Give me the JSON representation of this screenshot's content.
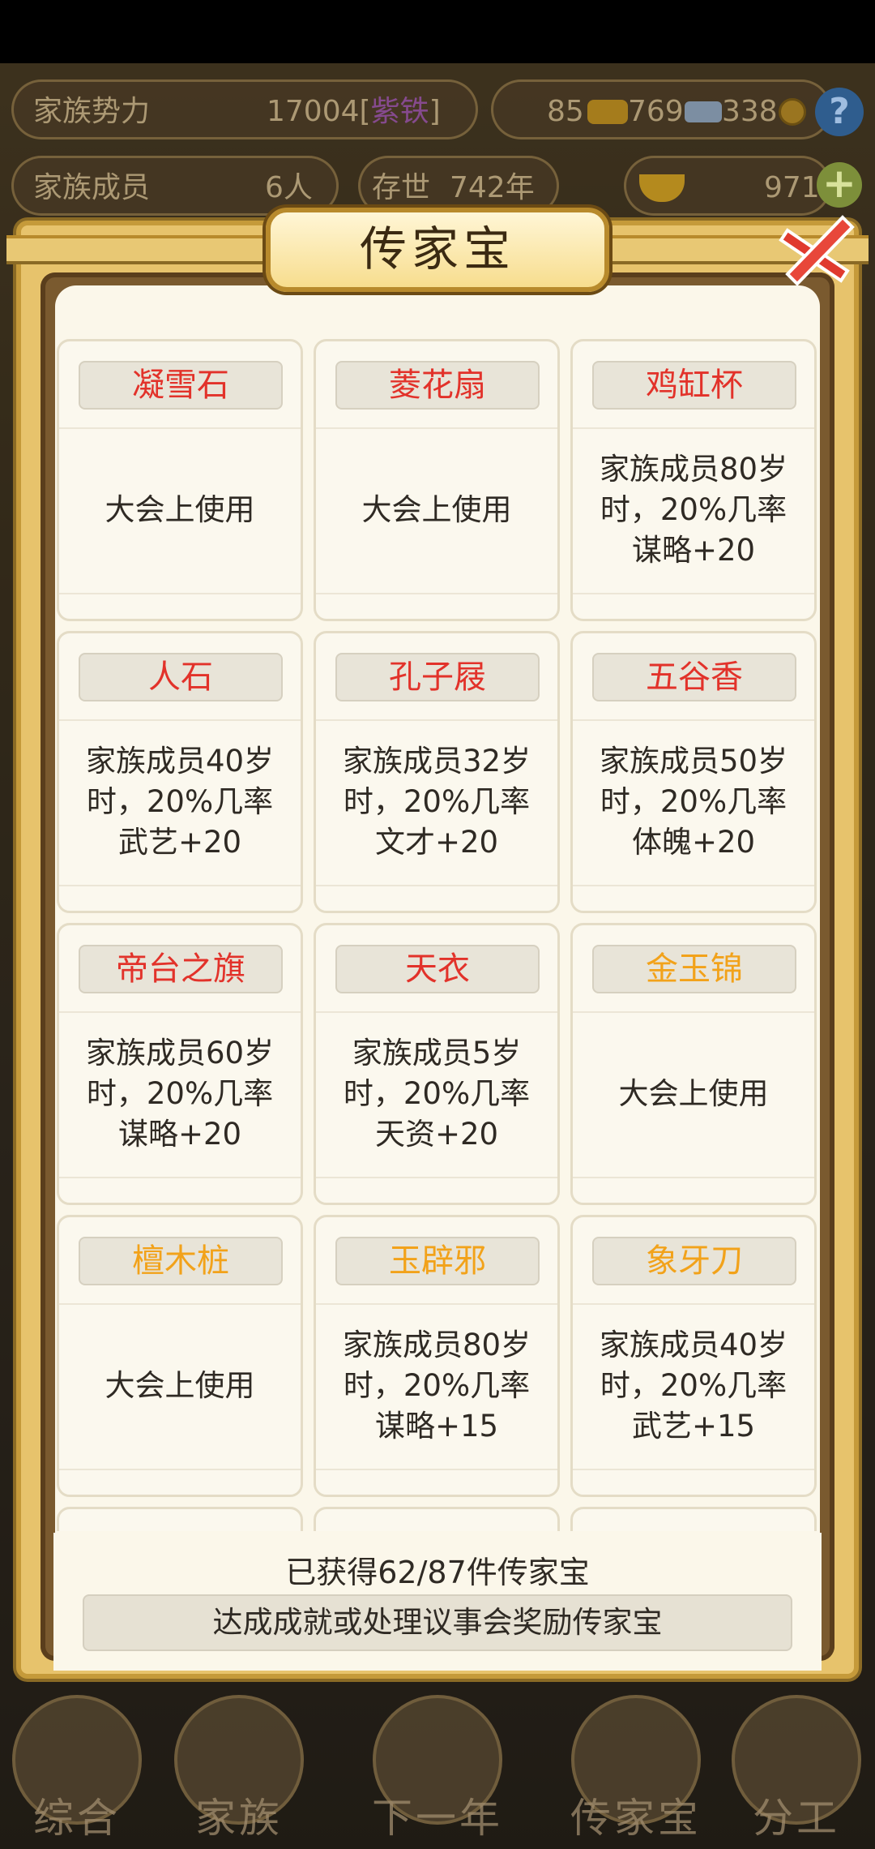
{
  "topbar": {
    "clan_power_label": "家族势力",
    "clan_power_value": "17004",
    "clan_rank_open": "[",
    "clan_rank": "紫铁",
    "clan_rank_close": "]",
    "gold_count": "85",
    "silver_count": "769",
    "coin_count": "338",
    "members_label": "家族成员",
    "members_value": "6人",
    "years_label": "存世",
    "years_value": "742年",
    "ingot_count": "971"
  },
  "modal": {
    "title": "传家宝",
    "items": [
      {
        "name": "凝雪石",
        "color": "#e2322a",
        "desc": "大会上使用"
      },
      {
        "name": "菱花扇",
        "color": "#e2322a",
        "desc": "大会上使用"
      },
      {
        "name": "鸡缸杯",
        "color": "#e2322a",
        "desc": "家族成员80岁\n时，20%几率\n谋略+20"
      },
      {
        "name": "人石",
        "color": "#e2322a",
        "desc": "家族成员40岁\n时，20%几率\n武艺+20"
      },
      {
        "name": "孔子屐",
        "color": "#e2322a",
        "desc": "家族成员32岁\n时，20%几率\n文才+20"
      },
      {
        "name": "五谷香",
        "color": "#e2322a",
        "desc": "家族成员50岁\n时，20%几率\n体魄+20"
      },
      {
        "name": "帝台之旗",
        "color": "#e2322a",
        "desc": "家族成员60岁\n时，20%几率\n谋略+20"
      },
      {
        "name": "天衣",
        "color": "#e2322a",
        "desc": "家族成员5岁\n时，20%几率\n天资+20"
      },
      {
        "name": "金玉锦",
        "color": "#f2a21a",
        "desc": "大会上使用"
      },
      {
        "name": "檀木桩",
        "color": "#f2a21a",
        "desc": "大会上使用"
      },
      {
        "name": "玉辟邪",
        "color": "#f2a21a",
        "desc": "家族成员80岁\n时，20%几率\n谋略+15"
      },
      {
        "name": "象牙刀",
        "color": "#f2a21a",
        "desc": "家族成员40岁\n时，20%几率\n武艺+15"
      }
    ],
    "collected_text": "已获得62/87件传家宝",
    "hint_text": "达成成就或处理议事会奖励传家宝"
  },
  "bottom_nav": {
    "items": [
      "综合",
      "家族",
      "下一年",
      "传家宝",
      "分工"
    ]
  }
}
